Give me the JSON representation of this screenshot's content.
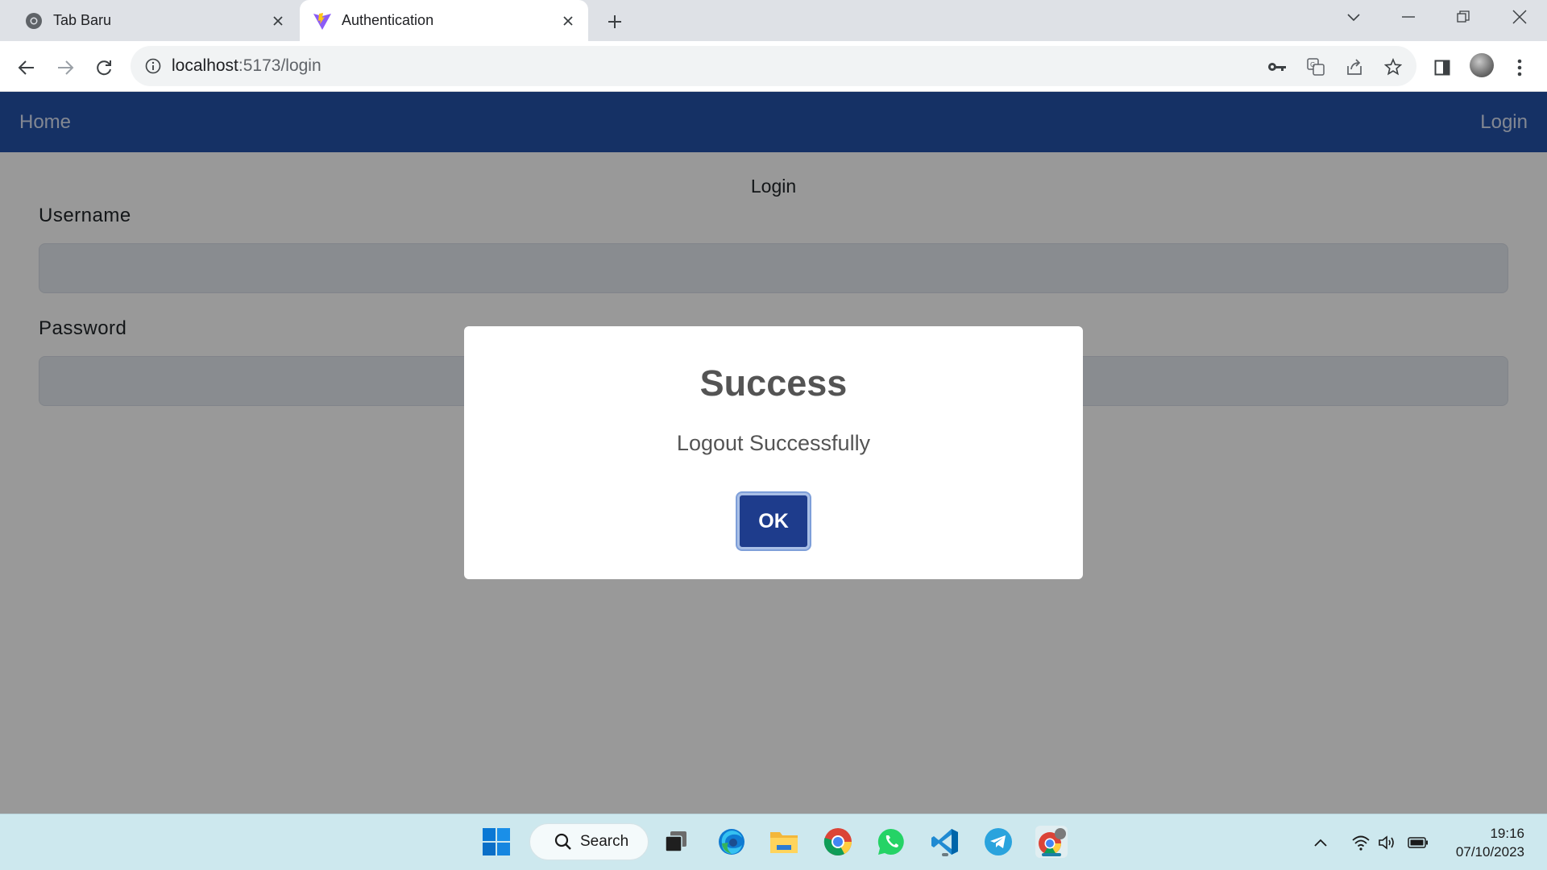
{
  "browser": {
    "tabs": [
      {
        "label": "Tab Baru",
        "active": false,
        "icon": "chrome-icon"
      },
      {
        "label": "Authentication",
        "active": true,
        "icon": "vite-icon"
      }
    ],
    "url_host": "localhost",
    "url_rest": ":5173/login"
  },
  "navbar": {
    "home_label": "Home",
    "login_label": "Login",
    "background": "#2352a8"
  },
  "form": {
    "title": "Login",
    "username_label": "Username",
    "username_value": "",
    "password_label": "Password",
    "password_value": ""
  },
  "modal": {
    "title": "Success",
    "message": "Logout Successfully",
    "ok_label": "OK",
    "button_color": "#1e3c8c"
  },
  "taskbar": {
    "search_label": "Search",
    "time": "19:16",
    "date": "07/10/2023",
    "apps": [
      "windows-start-icon",
      "task-view-icon",
      "edge-icon",
      "file-explorer-icon",
      "chrome-icon",
      "whatsapp-icon",
      "vscode-icon",
      "telegram-icon",
      "chrome-profile-icon"
    ]
  }
}
